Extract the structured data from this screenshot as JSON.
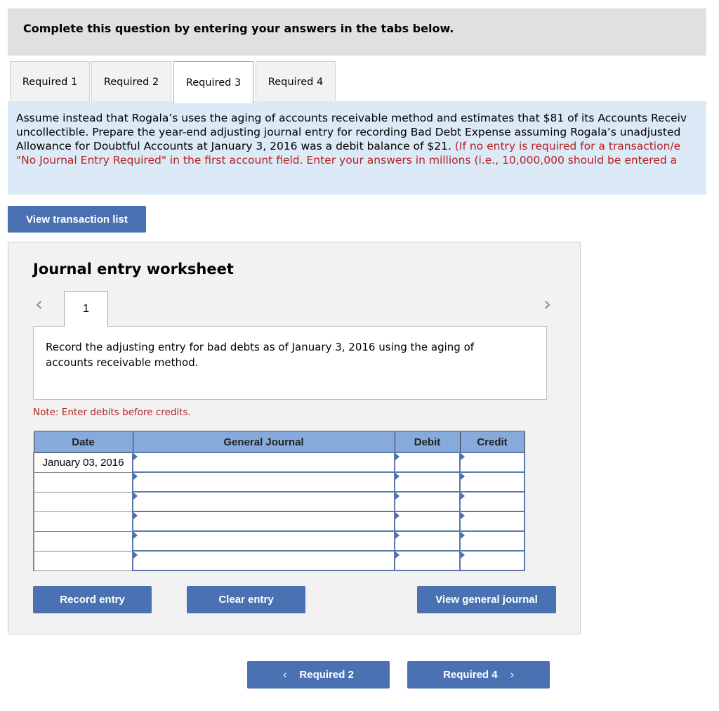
{
  "instruction": "Complete this question by entering your answers in the tabs below.",
  "tabs": [
    {
      "label": "Required 1",
      "active": false
    },
    {
      "label": "Required 2",
      "active": false
    },
    {
      "label": "Required 3",
      "active": true
    },
    {
      "label": "Required 4",
      "active": false
    }
  ],
  "question": {
    "line1": "Assume instead that Rogala’s uses the aging of accounts receivable method and estimates that $81 of its Accounts Receiv",
    "line2": "uncollectible. Prepare the year-end adjusting journal entry for recording Bad Debt Expense assuming  Rogala’s unadjusted",
    "line3_black": "Allowance for Doubtful Accounts at January 3, 2016 was a debit balance of $21. ",
    "line3_red": "(If no entry is required for a transaction/e",
    "line4_red": "\"No Journal Entry Required\" in the first account field. Enter your answers in millions (i.e., 10,000,000 should be entered a"
  },
  "view_transaction_list_label": "View transaction list",
  "worksheet": {
    "title": "Journal entry worksheet",
    "prev_icon": "chevron-left-icon",
    "next_icon": "chevron-right-icon",
    "entry_tab": "1",
    "description": "Record the adjusting entry for bad debts as of January 3, 2016 using the aging of accounts receivable method.",
    "note": "Note: Enter debits before credits.",
    "table": {
      "headers": {
        "date": "Date",
        "journal": "General Journal",
        "debit": "Debit",
        "credit": "Credit"
      },
      "rows": [
        {
          "date": "January 03, 2016",
          "account": "",
          "debit": "",
          "credit": ""
        },
        {
          "date": "",
          "account": "",
          "debit": "",
          "credit": ""
        },
        {
          "date": "",
          "account": "",
          "debit": "",
          "credit": ""
        },
        {
          "date": "",
          "account": "",
          "debit": "",
          "credit": ""
        },
        {
          "date": "",
          "account": "",
          "debit": "",
          "credit": ""
        },
        {
          "date": "",
          "account": "",
          "debit": "",
          "credit": ""
        }
      ]
    },
    "record_entry_label": "Record entry",
    "clear_entry_label": "Clear entry",
    "view_general_journal_label": "View general journal"
  },
  "footer_nav": {
    "prev_label": "Required 2",
    "next_label": "Required 4"
  },
  "colors": {
    "button_blue": "#4a72b2",
    "header_blue": "#86aadc",
    "question_bg": "#dce9f7",
    "red_text": "#b22222"
  }
}
